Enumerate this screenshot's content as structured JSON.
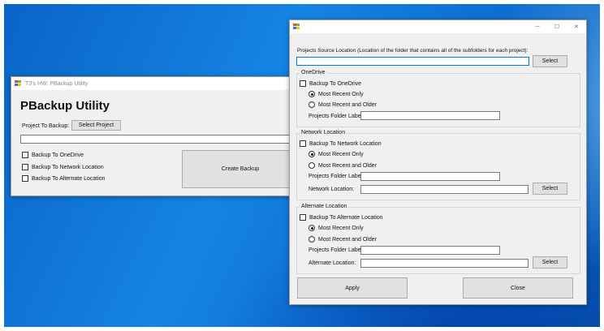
{
  "backup_window": {
    "title": "T3's HW: PBackup Utility",
    "heading": "PBackup Utility",
    "project_label": "Project To Backup:",
    "select_project_label": "Select Project",
    "project_path_value": "",
    "checkboxes": [
      {
        "label": "Backup To OneDrive",
        "checked": false
      },
      {
        "label": "Backup To Network Location",
        "checked": false
      },
      {
        "label": "Backup To Alternate Location",
        "checked": false
      }
    ],
    "create_backup_label": "Create Backup"
  },
  "settings_window": {
    "title": "",
    "caption_buttons": {
      "minimize": "─",
      "maximize": "☐",
      "close": "✕"
    },
    "source_label": "Projects Source Location (Location of the folder that contains all of the subfolders for each project):",
    "source_value": "",
    "source_select_label": "Select",
    "onedrive": {
      "group_title": "OneDrive",
      "checkbox_label": "Backup To OneDrive",
      "radio_recent_only": "Most Recent Only",
      "radio_recent_older": "Most Recent and Older",
      "folder_label": "Projects Folder Label:",
      "folder_value": ""
    },
    "network": {
      "group_title": "Network Location",
      "checkbox_label": "Backup To Network Location",
      "radio_recent_only": "Most Recent Only",
      "radio_recent_older": "Most Recent and Older",
      "folder_label": "Projects Folder Label:",
      "folder_value": "",
      "location_label": "Network Location:",
      "location_value": "",
      "select_label": "Select"
    },
    "alternate": {
      "group_title": "Alternate Location",
      "checkbox_label": "Backup To Alternate Location",
      "radio_recent_only": "Most Recent Only",
      "radio_recent_older": "Most Recent and Older",
      "folder_label": "Projects Folder Label:",
      "folder_value": "",
      "location_label": "Alternate Location:",
      "location_value": "",
      "select_label": "Select"
    },
    "apply_label": "Apply",
    "close_label": "Close"
  },
  "icons": {
    "app": "winforms-app-icon"
  },
  "colors": {
    "desktop": "#0d70d3",
    "window": "#f0f0f0",
    "button": "#e1e1e1",
    "focus": "#0078d7"
  }
}
